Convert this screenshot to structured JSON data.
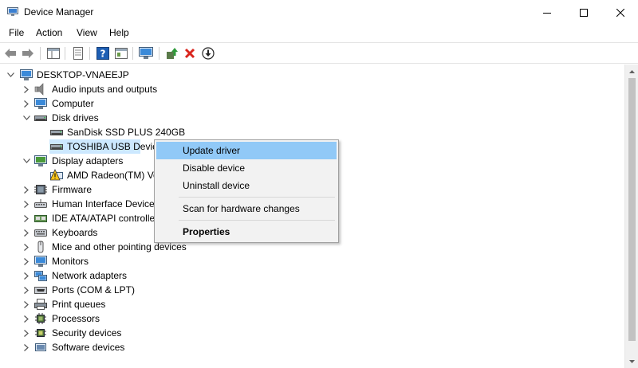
{
  "window": {
    "title": "Device Manager",
    "controls": {
      "minimize": "—",
      "maximize": "☐",
      "close": "✕"
    }
  },
  "menu": [
    "File",
    "Action",
    "View",
    "Help"
  ],
  "toolbar": {
    "icons": [
      "back-arrow-icon",
      "forward-arrow-icon",
      "show-hide-console-tree-icon",
      "properties-icon",
      "help-icon",
      "view-icon",
      "scan-hardware-icon",
      "update-driver-icon",
      "uninstall-device-icon",
      "enable-device-icon"
    ]
  },
  "tree": {
    "root": "DESKTOP-VNAEEJP",
    "items": [
      {
        "label": "Audio inputs and outputs",
        "expanded": false
      },
      {
        "label": "Computer",
        "expanded": false
      },
      {
        "label": "Disk drives",
        "expanded": true
      },
      {
        "label": "SanDisk SSD PLUS 240GB",
        "child": true
      },
      {
        "label": "TOSHIBA USB Device",
        "child": true,
        "selected": true
      },
      {
        "label": "Display adapters",
        "expanded": true
      },
      {
        "label": "AMD Radeon(TM) Ve",
        "child": true,
        "warning": true
      },
      {
        "label": "Firmware",
        "expanded": false
      },
      {
        "label": "Human Interface Device",
        "expanded": false
      },
      {
        "label": "IDE ATA/ATAPI controller",
        "expanded": false
      },
      {
        "label": "Keyboards",
        "expanded": false
      },
      {
        "label": "Mice and other pointing devices",
        "expanded": false
      },
      {
        "label": "Monitors",
        "expanded": false
      },
      {
        "label": "Network adapters",
        "expanded": false
      },
      {
        "label": "Ports (COM & LPT)",
        "expanded": false
      },
      {
        "label": "Print queues",
        "expanded": false
      },
      {
        "label": "Processors",
        "expanded": false
      },
      {
        "label": "Security devices",
        "expanded": false
      },
      {
        "label": "Software devices",
        "expanded": false
      }
    ]
  },
  "context_menu": {
    "items": [
      "Update driver",
      "Disable device",
      "Uninstall device",
      "Scan for hardware changes",
      "Properties"
    ],
    "highlighted": "Update driver"
  },
  "colors": {
    "selection": "#cce8ff",
    "menu_highlight": "#91c9f7",
    "menu_bg": "#f2f2f2",
    "remove_red": "#d9251d",
    "help_blue": "#1e5fb4"
  }
}
